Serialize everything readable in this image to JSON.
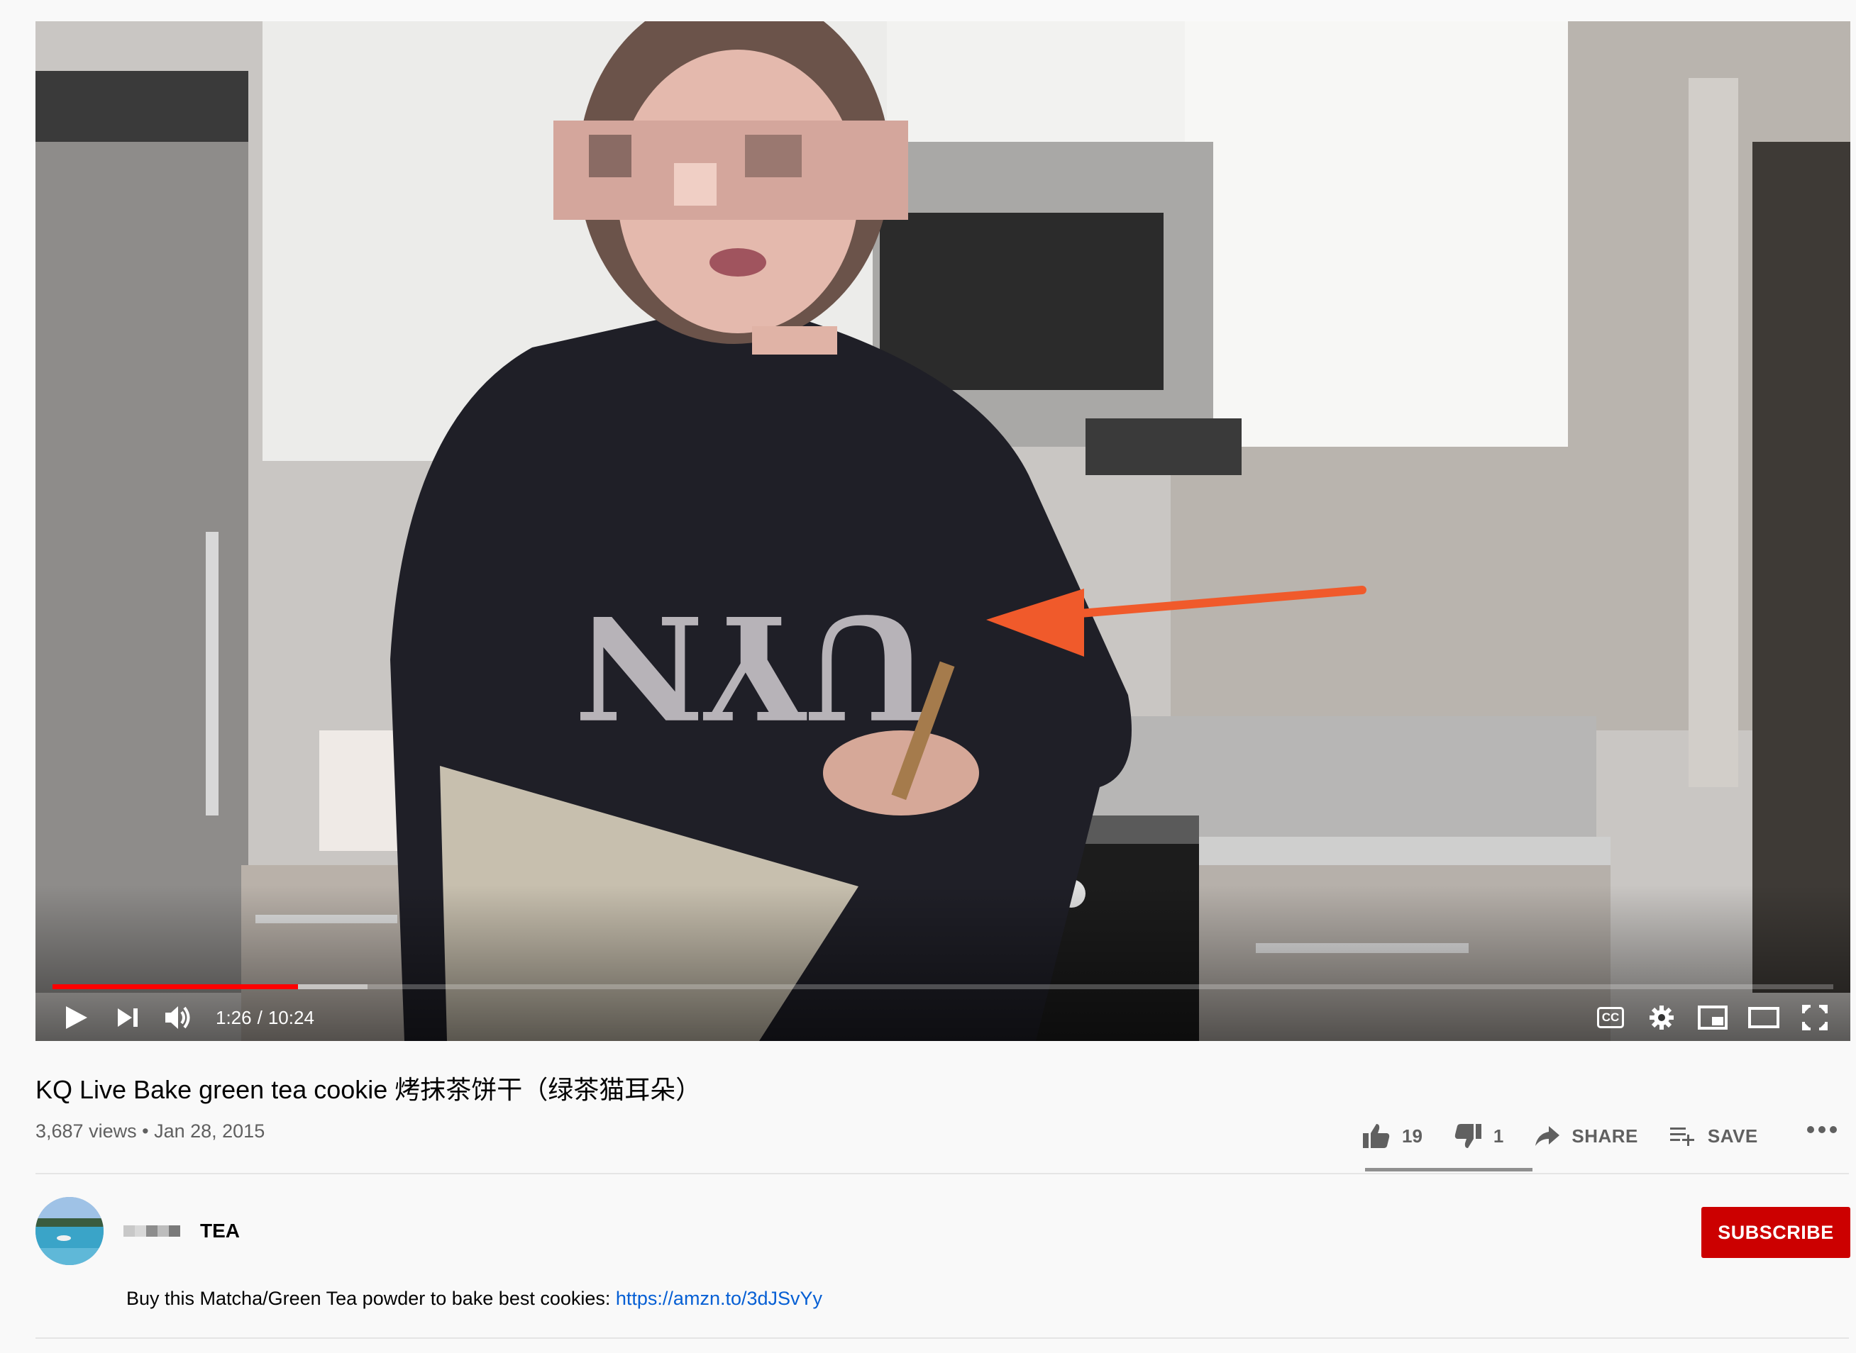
{
  "player": {
    "current_time": "1:26",
    "separator": "/",
    "duration": "10:24",
    "played_fraction": 0.138,
    "buffered_fraction": 0.177,
    "controls": [
      "play-icon",
      "next-icon",
      "volume-icon",
      "cc-icon",
      "settings-icon",
      "miniplayer-icon",
      "theater-icon",
      "fullscreen-icon"
    ],
    "cc_label": "CC",
    "progress_color": "#ff0000"
  },
  "video": {
    "title": "KQ Live Bake green tea cookie 烤抹茶饼干（绿茶猫耳朵）",
    "views": "3,687 views",
    "dot": "•",
    "date": "Jan 28, 2015"
  },
  "actions": {
    "likes": "19",
    "dislikes": "1",
    "share_label": "SHARE",
    "save_label": "SAVE"
  },
  "channel": {
    "name_visible": "TEA",
    "subscribe_label": "SUBSCRIBE",
    "subscribe_color": "#cc0000"
  },
  "description": {
    "text": "Buy this Matcha/Green Tea powder to bake best cookies: ",
    "link": "https://amzn.to/3dJSvYy",
    "link_color": "#065fd4"
  },
  "annotation": {
    "arrow_color": "#f05a2b"
  }
}
